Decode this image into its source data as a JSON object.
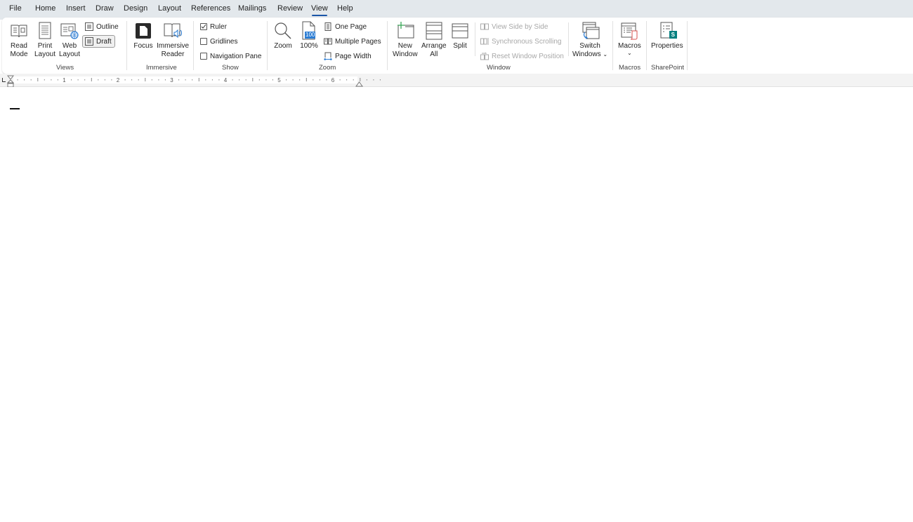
{
  "menu": {
    "tabs": [
      {
        "label": "File"
      },
      {
        "label": "Home"
      },
      {
        "label": "Insert"
      },
      {
        "label": "Draw"
      },
      {
        "label": "Design"
      },
      {
        "label": "Layout"
      },
      {
        "label": "References"
      },
      {
        "label": "Mailings"
      },
      {
        "label": "Review"
      },
      {
        "label": "View",
        "active": true
      },
      {
        "label": "Help"
      }
    ],
    "accent_color": "#1a56a8"
  },
  "ribbon": {
    "views": {
      "group_label": "Views",
      "read_mode": {
        "line1": "Read",
        "line2": "Mode",
        "icon": "book-open-icon"
      },
      "print_layout": {
        "line1": "Print",
        "line2": "Layout",
        "icon": "page-icon"
      },
      "web_layout": {
        "line1": "Web",
        "line2": "Layout",
        "icon": "globe-page-icon"
      },
      "outline": {
        "label": "Outline",
        "icon": "outline-icon"
      },
      "draft": {
        "label": "Draft",
        "icon": "draft-icon",
        "selected": true
      }
    },
    "immersive": {
      "group_label": "Immersive",
      "focus": {
        "label": "Focus",
        "icon": "focus-icon"
      },
      "immersive_reader": {
        "line1": "Immersive",
        "line2": "Reader",
        "icon": "immersive-reader-icon"
      }
    },
    "show": {
      "group_label": "Show",
      "ruler": {
        "label": "Ruler",
        "checked": true
      },
      "gridlines": {
        "label": "Gridlines",
        "checked": false
      },
      "navigation_pane": {
        "label": "Navigation Pane",
        "checked": false
      }
    },
    "zoom": {
      "group_label": "Zoom",
      "zoom": {
        "label": "Zoom",
        "icon": "magnifier-icon"
      },
      "hundred": {
        "label": "100%",
        "badge": "100",
        "icon": "hundred-percent-icon"
      },
      "one_page": {
        "label": "One Page"
      },
      "multiple_pages": {
        "label": "Multiple Pages"
      },
      "page_width": {
        "label": "Page Width"
      }
    },
    "window": {
      "group_label": "Window",
      "new_window": {
        "line1": "New",
        "line2": "Window"
      },
      "arrange_all": {
        "line1": "Arrange",
        "line2": "All"
      },
      "split": {
        "label": "Split"
      },
      "view_side_by_side": {
        "label": "View Side by Side",
        "enabled": false
      },
      "synchronous_scrolling": {
        "label": "Synchronous Scrolling",
        "enabled": false
      },
      "reset_window_position": {
        "label": "Reset Window Position",
        "enabled": false
      },
      "switch_windows": {
        "line1": "Switch",
        "line2": "Windows"
      }
    },
    "macros": {
      "group_label": "Macros",
      "macros": {
        "label": "Macros"
      }
    },
    "sharepoint": {
      "group_label": "SharePoint",
      "properties": {
        "label": "Properties",
        "badge": "S"
      }
    }
  },
  "ruler": {
    "numbers": [
      "1",
      "2",
      "3",
      "4",
      "5",
      "6"
    ]
  }
}
